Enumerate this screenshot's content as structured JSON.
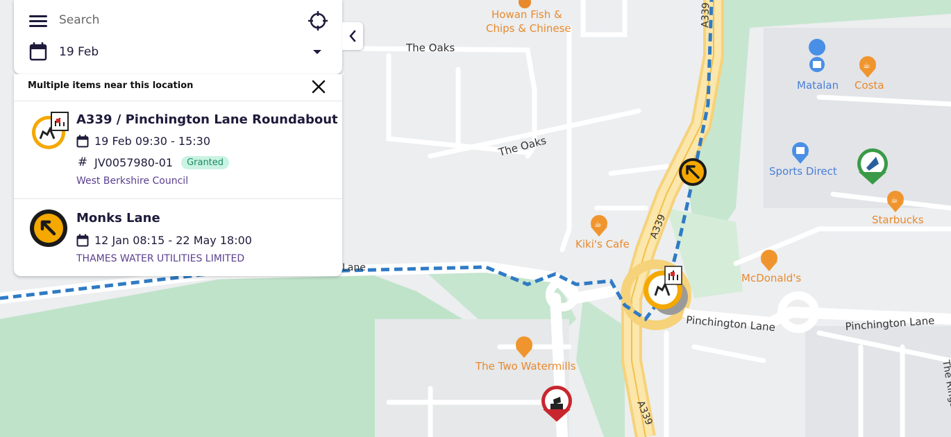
{
  "panel": {
    "search": {
      "placeholder": "Search"
    },
    "date": {
      "value": "19 Feb"
    }
  },
  "results": {
    "header": "Multiple items near this location",
    "items": [
      {
        "title": "A339 / Pinchington Lane Roundabout",
        "datetime": "19 Feb 09:30 - 15:30",
        "reference": "JV0057980-01",
        "status": "Granted",
        "organisation": "West Berkshire Council",
        "icon": "roadworks-icon"
      },
      {
        "title": "Monks Lane",
        "datetime": "12 Jan 08:15 - 22 May 18:00",
        "organisation": "THAMES WATER UTILITIES LIMITED",
        "icon": "diversion-arrow-icon"
      }
    ]
  },
  "map": {
    "streets": [
      "The Oaks",
      "The Oaks",
      "A339",
      "A339",
      "A339",
      "Pinchington Lane",
      "Pinchington Lane",
      "Lane",
      "The Rings"
    ],
    "pois": [
      {
        "name": "Howan Fish & Chips & Chinese",
        "type": "food"
      },
      {
        "name": "Matalan",
        "type": "shop"
      },
      {
        "name": "Costa",
        "type": "cafe"
      },
      {
        "name": "Sports Direct",
        "type": "shop"
      },
      {
        "name": "Starbucks",
        "type": "cafe"
      },
      {
        "name": "Kiki's Cafe",
        "type": "cafe"
      },
      {
        "name": "McDonald's",
        "type": "food"
      },
      {
        "name": "The Two Watermills",
        "type": "pub"
      }
    ]
  },
  "colors": {
    "accent": "#f5a800",
    "diversion_route": "#2f7bc4",
    "primary_text": "#1d1a3a",
    "granted_badge": "#c9f3e3"
  }
}
